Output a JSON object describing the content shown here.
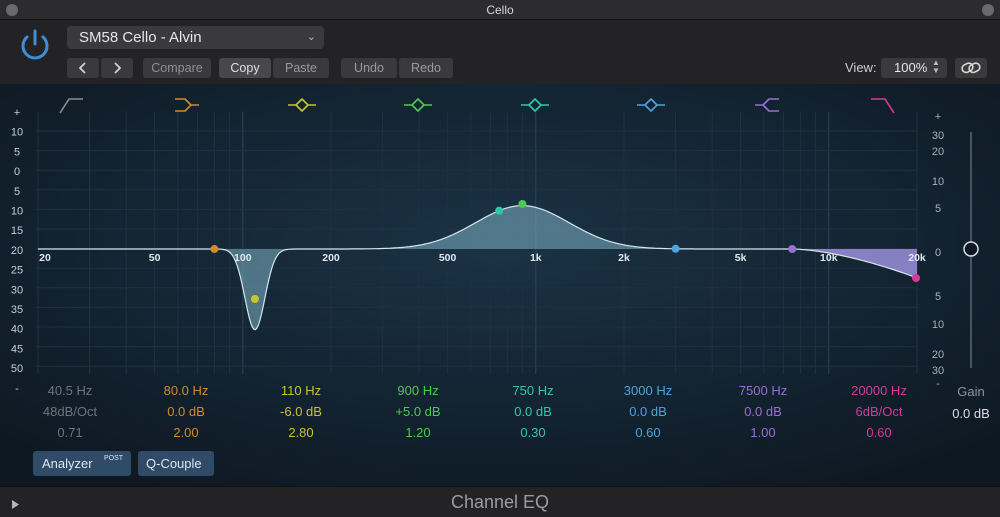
{
  "window": {
    "title": "Cello"
  },
  "header": {
    "preset": "SM58 Cello - Alvin",
    "compare": "Compare",
    "copy": "Copy",
    "paste": "Paste",
    "undo": "Undo",
    "redo": "Redo",
    "view_label": "View:",
    "view_value": "100%"
  },
  "left_scale": [
    "+",
    "10",
    "5",
    "0",
    "5",
    "10",
    "15",
    "20",
    "25",
    "30",
    "35",
    "40",
    "45",
    "50",
    "-"
  ],
  "right_scale": [
    "+",
    "30",
    "20",
    "10",
    "5",
    "0",
    "5",
    "10",
    "20",
    "30",
    "-"
  ],
  "freq_labels": [
    "20",
    "50",
    "100",
    "200",
    "500",
    "1k",
    "2k",
    "5k",
    "10k",
    "20k"
  ],
  "bands": [
    {
      "freq": "40.5 Hz",
      "gain": "48dB/Oct",
      "q": "0.71",
      "color": "#8a8d92",
      "icon": "low-cut-icon"
    },
    {
      "freq": "80.0 Hz",
      "gain": "0.0 dB",
      "q": "2.00",
      "color": "#d08a2c",
      "icon": "low-shelf-icon"
    },
    {
      "freq": "110 Hz",
      "gain": "-6.0 dB",
      "q": "2.80",
      "color": "#c9c42c",
      "icon": "peak-1-icon"
    },
    {
      "freq": "900 Hz",
      "gain": "+5.0 dB",
      "q": "1.20",
      "color": "#4fc953",
      "icon": "peak-2-icon"
    },
    {
      "freq": "750 Hz",
      "gain": "0.0 dB",
      "q": "0.30",
      "color": "#2fc9a8",
      "icon": "peak-3-icon"
    },
    {
      "freq": "3000 Hz",
      "gain": "0.0 dB",
      "q": "0.60",
      "color": "#4fa3dc",
      "icon": "peak-4-icon"
    },
    {
      "freq": "7500 Hz",
      "gain": "0.0 dB",
      "q": "1.00",
      "color": "#9a6fd2",
      "icon": "high-shelf-icon"
    },
    {
      "freq": "20000 Hz",
      "gain": "6dB/Oct",
      "q": "0.60",
      "color": "#d23b9a",
      "icon": "high-cut-icon"
    }
  ],
  "gain": {
    "label": "Gain",
    "value": "0.0 dB"
  },
  "analyzer": {
    "label": "Analyzer",
    "badge": "POST"
  },
  "qcouple": {
    "label": "Q-Couple"
  },
  "footer": {
    "name": "Channel EQ"
  }
}
